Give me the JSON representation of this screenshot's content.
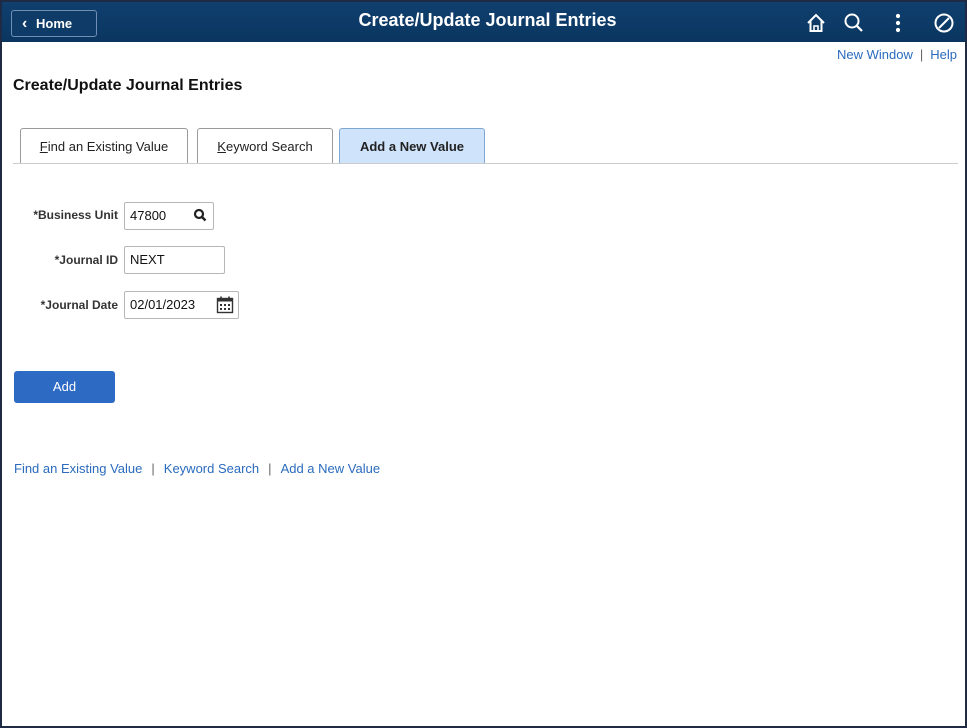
{
  "header": {
    "home_label": "Home",
    "title": "Create/Update Journal Entries",
    "icons": [
      "home-icon",
      "search-icon",
      "more-vertical-icon",
      "navbar-compass-icon"
    ]
  },
  "top_links": {
    "new_window": "New Window",
    "separator": "|",
    "help": "Help"
  },
  "page": {
    "title": "Create/Update Journal Entries"
  },
  "tabs": [
    {
      "label": "Find an Existing Value",
      "accesskey": "F",
      "rest": "ind an Existing Value",
      "active": false
    },
    {
      "label": "Keyword Search",
      "accesskey": "K",
      "rest": "eyword Search",
      "active": false
    },
    {
      "label": "Add a New Value",
      "active": true
    }
  ],
  "form": {
    "business_unit": {
      "label": "*Business Unit",
      "value": "47800"
    },
    "journal_id": {
      "label": "*Journal ID",
      "value": "NEXT"
    },
    "journal_date": {
      "label": "*Journal Date",
      "value": "02/01/2023"
    }
  },
  "actions": {
    "add_label": "Add"
  },
  "bottom_links": {
    "find": "Find an Existing Value",
    "keyword": "Keyword Search",
    "add": "Add a New Value",
    "separator": "|"
  },
  "colors": {
    "banner": "#10406f",
    "link": "#2a6bbd",
    "primary_button": "#2d6ac4",
    "active_tab": "#cfe3fb"
  }
}
